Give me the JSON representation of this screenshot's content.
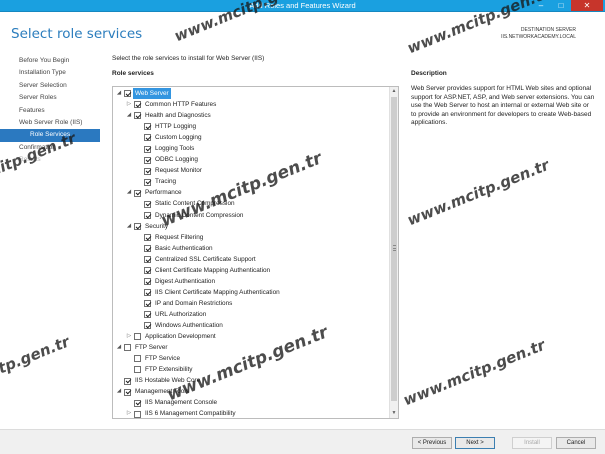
{
  "window": {
    "title": "Add Roles and Features Wizard",
    "minimize_glyph": "–",
    "maximize_glyph": "□",
    "close_glyph": "✕"
  },
  "header": {
    "page_title": "Select role services",
    "destination_label": "DESTINATION SERVER",
    "destination_server": "IIS.NETWORKACADEMY.LOCAL"
  },
  "nav": {
    "items": [
      {
        "label": "Before You Begin"
      },
      {
        "label": "Installation Type"
      },
      {
        "label": "Server Selection"
      },
      {
        "label": "Server Roles"
      },
      {
        "label": "Features"
      },
      {
        "label": "Web Server Role (IIS)"
      },
      {
        "label": "Role Services"
      },
      {
        "label": "Confirmation"
      },
      {
        "label": "Results"
      }
    ]
  },
  "main": {
    "instruction": "Select the role services to install for Web Server (IIS)",
    "role_services_heading": "Role services",
    "description_heading": "Description",
    "description_text": "Web Server provides support for HTML Web sites and optional support for ASP.NET, ASP, and Web server extensions. You can use the Web Server to host an internal or external Web site or to provide an environment for developers to create Web-based applications."
  },
  "tree": [
    {
      "label": "Web Server",
      "level": 0,
      "expander": "expanded",
      "checked": true,
      "selected": true
    },
    {
      "label": "Common HTTP Features",
      "level": 1,
      "expander": "collapsed",
      "checked": true
    },
    {
      "label": "Health and Diagnostics",
      "level": 1,
      "expander": "expanded",
      "checked": true
    },
    {
      "label": "HTTP Logging",
      "level": 2,
      "expander": "none",
      "checked": true
    },
    {
      "label": "Custom Logging",
      "level": 2,
      "expander": "none",
      "checked": true
    },
    {
      "label": "Logging Tools",
      "level": 2,
      "expander": "none",
      "checked": true
    },
    {
      "label": "ODBC Logging",
      "level": 2,
      "expander": "none",
      "checked": true
    },
    {
      "label": "Request Monitor",
      "level": 2,
      "expander": "none",
      "checked": true
    },
    {
      "label": "Tracing",
      "level": 2,
      "expander": "none",
      "checked": true
    },
    {
      "label": "Performance",
      "level": 1,
      "expander": "expanded",
      "checked": true
    },
    {
      "label": "Static Content Compression",
      "level": 2,
      "expander": "none",
      "checked": true
    },
    {
      "label": "Dynamic Content Compression",
      "level": 2,
      "expander": "none",
      "checked": true
    },
    {
      "label": "Security",
      "level": 1,
      "expander": "expanded",
      "checked": true
    },
    {
      "label": "Request Filtering",
      "level": 2,
      "expander": "none",
      "checked": true
    },
    {
      "label": "Basic Authentication",
      "level": 2,
      "expander": "none",
      "checked": true
    },
    {
      "label": "Centralized SSL Certificate Support",
      "level": 2,
      "expander": "none",
      "checked": true
    },
    {
      "label": "Client Certificate Mapping Authentication",
      "level": 2,
      "expander": "none",
      "checked": true
    },
    {
      "label": "Digest Authentication",
      "level": 2,
      "expander": "none",
      "checked": true
    },
    {
      "label": "IIS Client Certificate Mapping Authentication",
      "level": 2,
      "expander": "none",
      "checked": true
    },
    {
      "label": "IP and Domain Restrictions",
      "level": 2,
      "expander": "none",
      "checked": true
    },
    {
      "label": "URL Authorization",
      "level": 2,
      "expander": "none",
      "checked": true
    },
    {
      "label": "Windows Authentication",
      "level": 2,
      "expander": "none",
      "checked": true
    },
    {
      "label": "Application Development",
      "level": 1,
      "expander": "collapsed",
      "checked": false
    },
    {
      "label": "FTP Server",
      "level": 0,
      "expander": "expanded",
      "checked": false
    },
    {
      "label": "FTP Service",
      "level": 1,
      "expander": "none",
      "checked": false
    },
    {
      "label": "FTP Extensibility",
      "level": 1,
      "expander": "none",
      "checked": false
    },
    {
      "label": "IIS Hostable Web Core",
      "level": 0,
      "expander": "none",
      "checked": true
    },
    {
      "label": "Management Tools",
      "level": 0,
      "expander": "expanded",
      "checked": true
    },
    {
      "label": "IIS Management Console",
      "level": 1,
      "expander": "none",
      "checked": true
    },
    {
      "label": "IIS 6 Management Compatibility",
      "level": 1,
      "expander": "collapsed",
      "checked": false
    }
  ],
  "footer": {
    "previous_label": "< Previous",
    "next_label": "Next >",
    "install_label": "Install",
    "cancel_label": "Cancel"
  },
  "watermark": {
    "text_full": "www.mcitp.gen.tr",
    "text_partial_1": "citp.gen.tr",
    "text_partial_2": "itp.gen.tr"
  },
  "icons": {
    "expanded": "◢",
    "collapsed": "▷",
    "scroll_up": "▲",
    "scroll_down": "▼"
  }
}
